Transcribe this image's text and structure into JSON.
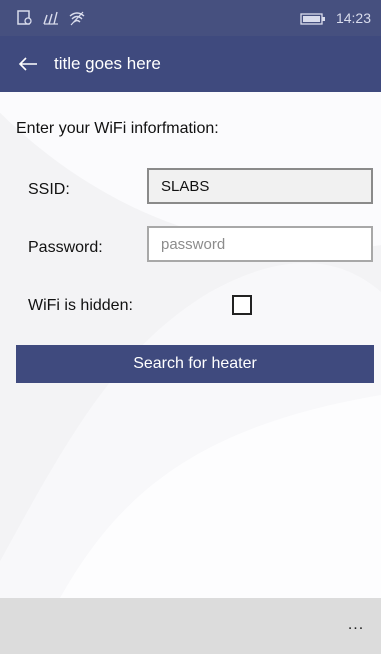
{
  "status_bar": {
    "time": "14:23",
    "icons": [
      "notification-icon",
      "signal-icon",
      "wifi-icon",
      "battery-icon"
    ]
  },
  "title_bar": {
    "title": "title goes here",
    "back_icon": "back-arrow-icon"
  },
  "form": {
    "heading": "Enter your WiFi inforfmation:",
    "ssid_label": "SSID:",
    "ssid_value": "SLABS",
    "password_label": "Password:",
    "password_placeholder": "password",
    "password_value": "",
    "hidden_label": "WiFi is hidden:",
    "hidden_checked": false,
    "search_button_label": "Search for heater"
  },
  "app_bar": {
    "more_label": "..."
  },
  "colors": {
    "accent": "#3f4a7e",
    "status_bar": "#46507f",
    "app_bar": "#dcdcdc",
    "page_background": "#f3f3f5"
  }
}
